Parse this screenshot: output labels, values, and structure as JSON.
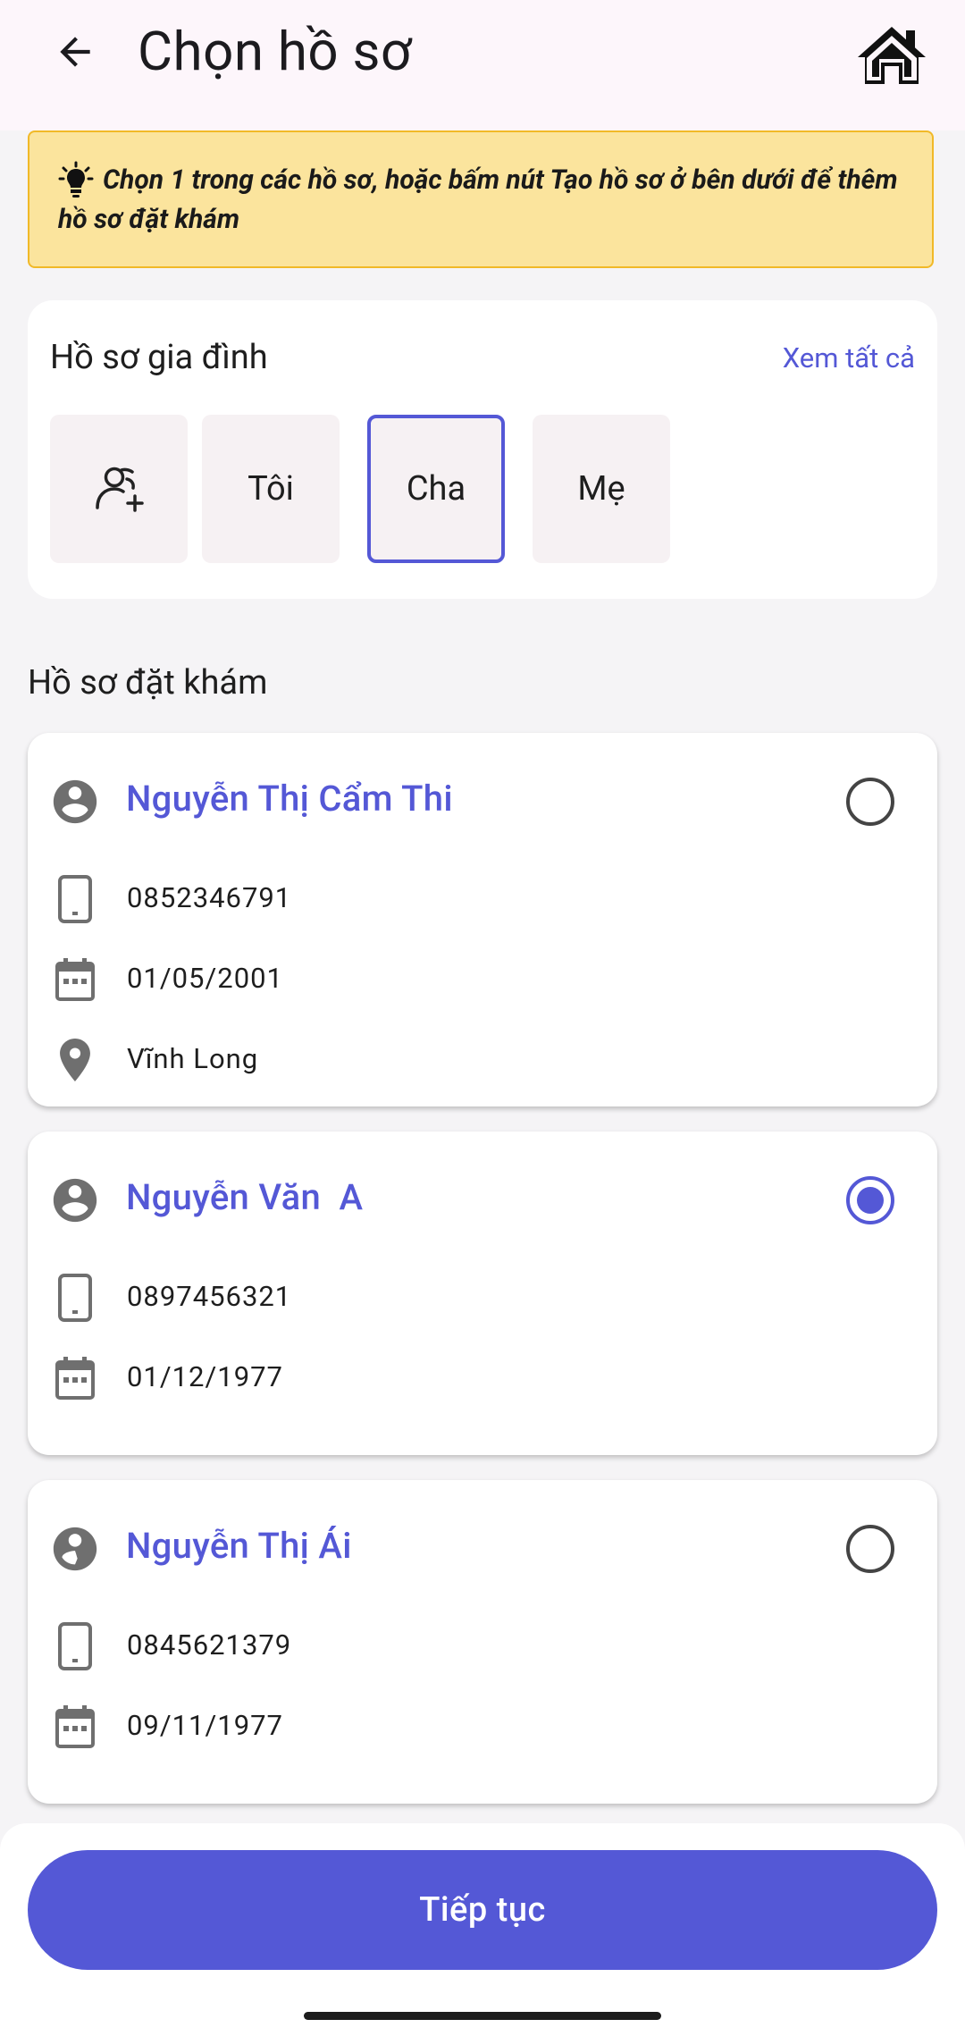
{
  "header": {
    "title": "Chọn hồ sơ"
  },
  "notice": {
    "text": "Chọn 1 trong các hồ sơ, hoặc bấm nút Tạo hồ sơ ở bên dưới để thêm hồ sơ đặt khám"
  },
  "family": {
    "title": "Hồ sơ gia đình",
    "see_all": "Xem tất cả",
    "tiles": [
      "Tôi",
      "Cha",
      "Mẹ"
    ],
    "selected": "Cha"
  },
  "section": {
    "title": "Hồ sơ đặt khám"
  },
  "profiles": [
    {
      "name": "Nguyễn Thị Cẩm Thi",
      "phone": "0852346791",
      "dob": "01/05/2001",
      "location": "Vĩnh Long",
      "selected": false
    },
    {
      "name": "Nguyễn Văn  A",
      "phone": "0897456321",
      "dob": "01/12/1977",
      "selected": true
    },
    {
      "name": "Nguyễn Thị Ái",
      "phone": "0845621379",
      "dob": "09/11/1977",
      "selected": false
    }
  ],
  "footer": {
    "continue_label": "Tiếp tục"
  },
  "colors": {
    "accent": "#5458d6",
    "notice_bg": "#fbe49d",
    "notice_border": "#f1b928"
  }
}
